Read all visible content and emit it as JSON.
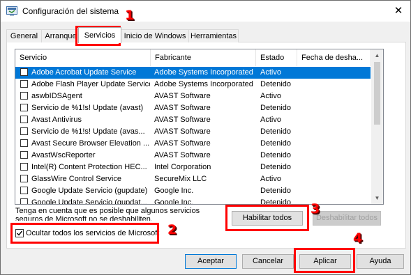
{
  "window": {
    "title": "Configuración del sistema",
    "close_glyph": "✕",
    "icon": "msconfig-icon"
  },
  "tabs": [
    {
      "label": "General"
    },
    {
      "label": "Arranque"
    },
    {
      "label": "Servicios",
      "active": true
    },
    {
      "label": "Inicio de Windows"
    },
    {
      "label": "Herramientas"
    }
  ],
  "services": {
    "columns": [
      "Servicio",
      "Fabricante",
      "Estado",
      "Fecha de desha..."
    ],
    "rows": [
      {
        "name": "Adobe Acrobat Update Service",
        "manufacturer": "Adobe Systems Incorporated",
        "state": "Activo",
        "date": "",
        "checked": false,
        "selected": true
      },
      {
        "name": "Adobe Flash Player Update Service",
        "manufacturer": "Adobe Systems Incorporated",
        "state": "Detenido",
        "date": "",
        "checked": false
      },
      {
        "name": "aswbIDSAgent",
        "manufacturer": "AVAST Software",
        "state": "Activo",
        "date": "",
        "checked": false
      },
      {
        "name": "Servicio de %1!s! Update (avast)",
        "manufacturer": "AVAST Software",
        "state": "Detenido",
        "date": "",
        "checked": false
      },
      {
        "name": "Avast Antivirus",
        "manufacturer": "AVAST Software",
        "state": "Activo",
        "date": "",
        "checked": false
      },
      {
        "name": "Servicio de %1!s! Update (avas...",
        "manufacturer": "AVAST Software",
        "state": "Detenido",
        "date": "",
        "checked": false
      },
      {
        "name": "Avast Secure Browser Elevation ...",
        "manufacturer": "AVAST Software",
        "state": "Detenido",
        "date": "",
        "checked": false
      },
      {
        "name": "AvastWscReporter",
        "manufacturer": "AVAST Software",
        "state": "Detenido",
        "date": "",
        "checked": false
      },
      {
        "name": "Intel(R) Content Protection HEC...",
        "manufacturer": "Intel Corporation",
        "state": "Detenido",
        "date": "",
        "checked": false
      },
      {
        "name": "GlassWire Control Service",
        "manufacturer": "SecureMix LLC",
        "state": "Activo",
        "date": "",
        "checked": false
      },
      {
        "name": "Google Update Servicio (gupdate)",
        "manufacturer": "Google Inc.",
        "state": "Detenido",
        "date": "",
        "checked": false
      },
      {
        "name": "Google Update Servicio (gupdat...",
        "manufacturer": "Google Inc.",
        "state": "Detenido",
        "date": "",
        "checked": false
      }
    ]
  },
  "note_text": "Tenga en cuenta que es posible que algunos servicios seguros de Microsoft no se deshabiliten.",
  "hide_ms_label": "Ocultar todos los servicios de Microsoft",
  "hide_ms_checked": true,
  "buttons": {
    "enable_all": "Habilitar todos",
    "disable_all": "Deshabilitar todos",
    "accept": "Aceptar",
    "cancel": "Cancelar",
    "apply": "Aplicar",
    "help": "Ayuda"
  },
  "annotations": {
    "marker_1": "1",
    "marker_2": "2",
    "marker_3": "3",
    "marker_4": "4",
    "color": "#ff0000"
  },
  "colors": {
    "selection": "#0078d7",
    "dialog_bg": "#f0f0f0",
    "primary_border": "#0078d7"
  }
}
